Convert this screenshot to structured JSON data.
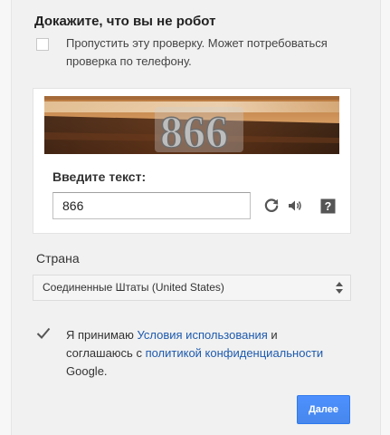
{
  "title": "Докажите, что вы не робот",
  "skip_check": {
    "checked": false,
    "label": "Пропустить эту проверку. Может потребоваться проверка по телефону."
  },
  "captcha": {
    "image_text": "866",
    "input_label": "Введите текст:",
    "input_value": "866",
    "refresh_icon": "refresh-icon",
    "audio_icon": "audio-icon",
    "help_icon": "help-icon",
    "help_glyph": "?"
  },
  "country": {
    "label": "Страна",
    "selected": "Соединенные Штаты (United States)"
  },
  "terms": {
    "checked": true,
    "text_1": "Я принимаю ",
    "link_1": "Условия использования",
    "text_2": " и соглашаюсь с ",
    "link_2": "политикой конфиденциальности",
    "text_3": " Google."
  },
  "next_button": "Далее",
  "colors": {
    "accent": "#4d90fe",
    "link": "#1e5aae",
    "background": "#f1f1f1"
  }
}
